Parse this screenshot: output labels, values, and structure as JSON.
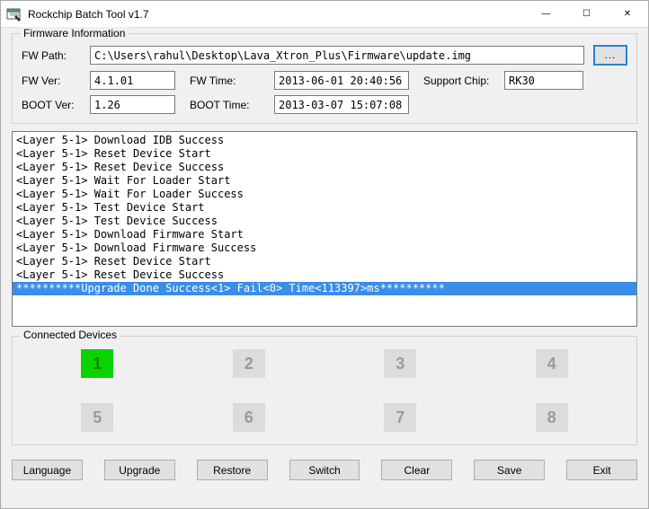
{
  "window": {
    "title": "Rockchip Batch Tool v1.7",
    "btn_min": "—",
    "btn_max": "☐",
    "btn_close": "✕"
  },
  "firmware": {
    "legend": "Firmware Information",
    "fwpath_label": "FW Path:",
    "fwpath_value": "C:\\Users\\rahul\\Desktop\\Lava_Xtron_Plus\\Firmware\\update.img",
    "browse_label": "...",
    "fwver_label": "FW Ver:",
    "fwver_value": "4.1.01",
    "fwtime_label": "FW Time:",
    "fwtime_value": "2013-06-01 20:40:56",
    "support_label": "Support Chip:",
    "support_value": "RK30",
    "bootver_label": "BOOT Ver:",
    "bootver_value": "1.26",
    "boottime_label": "BOOT Time:",
    "boottime_value": "2013-03-07 15:07:08"
  },
  "log": {
    "lines": [
      "<Layer 5-1> Download IDB Success",
      "<Layer 5-1> Reset Device Start",
      "<Layer 5-1> Reset Device Success",
      "<Layer 5-1> Wait For Loader Start",
      "<Layer 5-1> Wait For Loader Success",
      "<Layer 5-1> Test Device Start",
      "<Layer 5-1> Test Device Success",
      "<Layer 5-1> Download Firmware Start",
      "<Layer 5-1> Download Firmware Success",
      "<Layer 5-1> Reset Device Start",
      "<Layer 5-1> Reset Device Success",
      "**********Upgrade Done Success<1> Fail<0> Time<113397>ms**********"
    ],
    "highlight_index": 11
  },
  "devices": {
    "legend": "Connected Devices",
    "slots": [
      {
        "n": "1",
        "active": true
      },
      {
        "n": "2",
        "active": false
      },
      {
        "n": "3",
        "active": false
      },
      {
        "n": "4",
        "active": false
      },
      {
        "n": "5",
        "active": false
      },
      {
        "n": "6",
        "active": false
      },
      {
        "n": "7",
        "active": false
      },
      {
        "n": "8",
        "active": false
      }
    ]
  },
  "buttons": {
    "language": "Language",
    "upgrade": "Upgrade",
    "restore": "Restore",
    "switch": "Switch",
    "clear": "Clear",
    "save": "Save",
    "exit": "Exit"
  }
}
